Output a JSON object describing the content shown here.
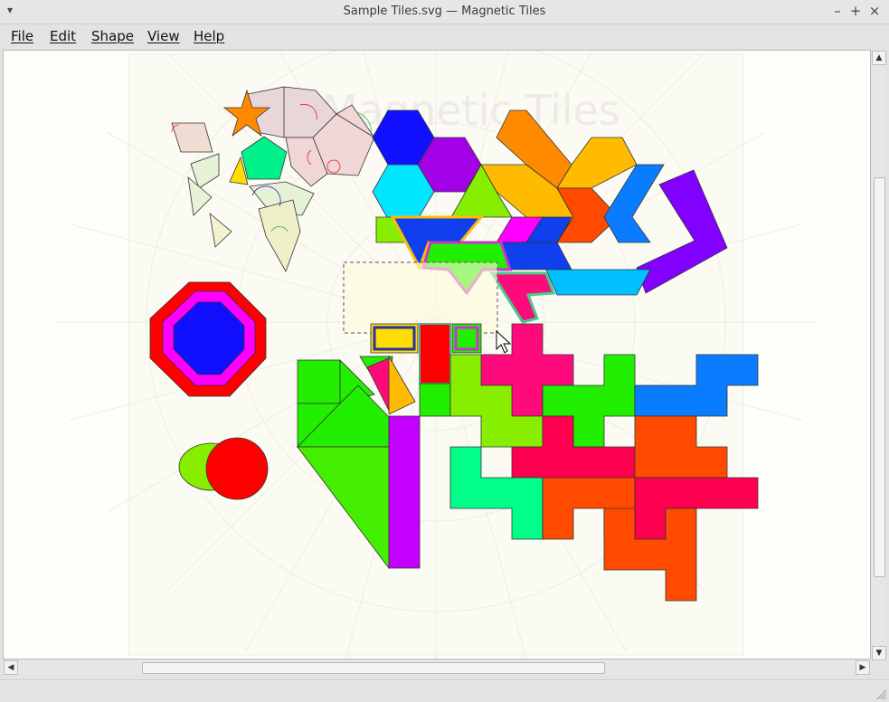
{
  "window": {
    "title": "Sample Tiles.svg — Magnetic Tiles",
    "minimize_glyph": "–",
    "maximize_glyph": "+",
    "close_glyph": "×",
    "window_menu_glyph": "▾"
  },
  "menubar": {
    "items": [
      {
        "label": "File"
      },
      {
        "label": "Edit"
      },
      {
        "label": "Shape"
      },
      {
        "label": "View"
      },
      {
        "label": "Help"
      }
    ]
  },
  "canvas": {
    "watermark": "Magnetic Tiles",
    "background_color": "#fffffa"
  },
  "scrollbars": {
    "up_glyph": "▲",
    "down_glyph": "▼",
    "left_glyph": "◀",
    "right_glyph": "▶"
  },
  "statusbar": {
    "text": ""
  },
  "colors": {
    "blue": "#1010ff",
    "purple": "#a400e8",
    "cyan": "#00e6ff",
    "orange": "#ff8a00",
    "amber": "#ffbb00",
    "sky": "#0a7cff",
    "orange_red": "#ff4a00",
    "violet": "#8200ff",
    "lime": "#88ee00",
    "green": "#22ee00",
    "magenta": "#ff00ff",
    "crimson": "#ff0050",
    "pink": "#ff0a7a",
    "red": "#ff0000",
    "yellow": "#ffdd00",
    "mint": "#00ff88",
    "light_blue": "#00c0ff"
  }
}
